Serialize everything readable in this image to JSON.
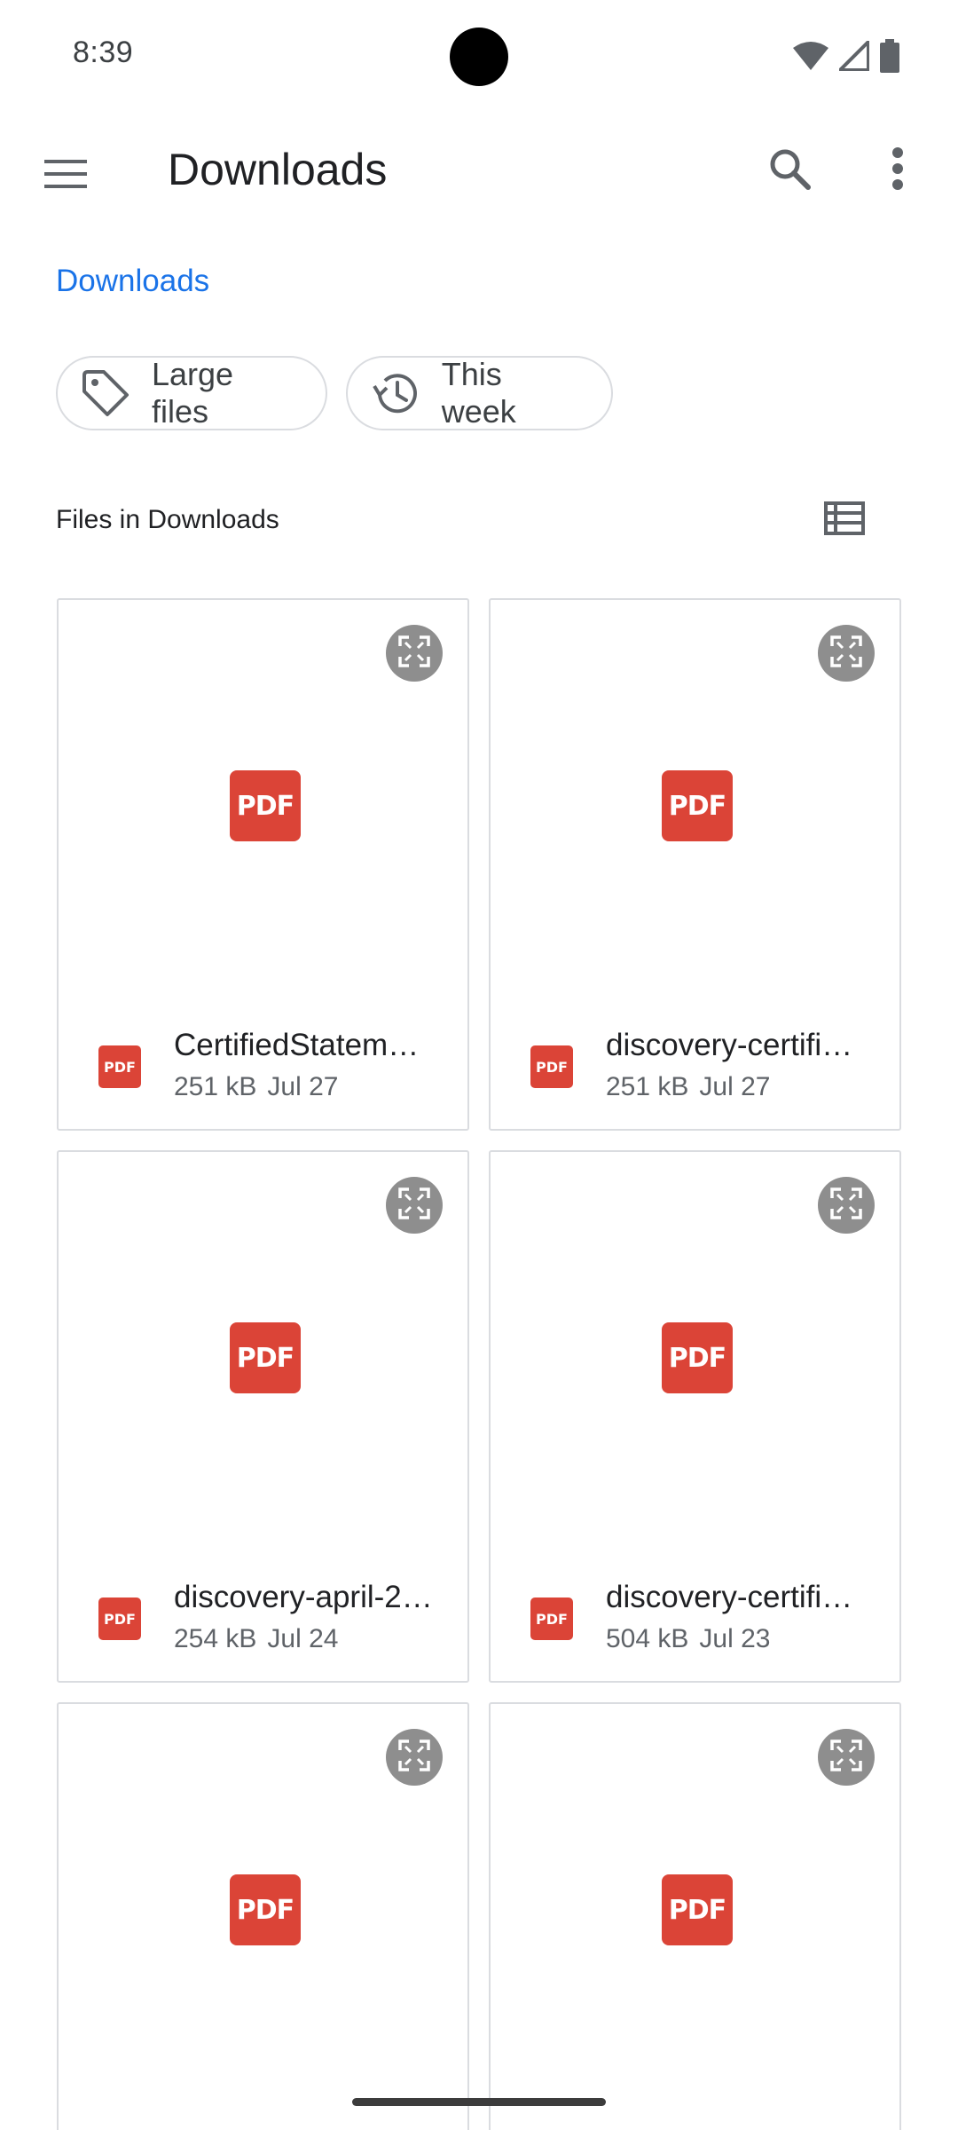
{
  "status_bar": {
    "time": "8:39",
    "icons": [
      "wifi-icon",
      "signal-icon",
      "battery-icon"
    ]
  },
  "app_bar": {
    "title": "Downloads",
    "icons": [
      "menu-icon",
      "search-icon",
      "more-vert-icon"
    ]
  },
  "breadcrumb": "Downloads",
  "chips": [
    {
      "label": "Large files",
      "icon": "label-tag-icon"
    },
    {
      "label": "This week",
      "icon": "history-icon"
    }
  ],
  "section": {
    "title": "Files in Downloads",
    "view_toggle_icon": "list-view-icon"
  },
  "files": [
    {
      "name": "CertifiedStatem…",
      "size": "251 kB",
      "date": "Jul 27",
      "type_badge": "PDF"
    },
    {
      "name": "discovery-certifi…",
      "size": "251 kB",
      "date": "Jul 27",
      "type_badge": "PDF"
    },
    {
      "name": "discovery-april-2…",
      "size": "254 kB",
      "date": "Jul 24",
      "type_badge": "PDF"
    },
    {
      "name": "discovery-certifi…",
      "size": "504 kB",
      "date": "Jul 23",
      "type_badge": "PDF"
    },
    {
      "name": "",
      "size": "",
      "date": "",
      "type_badge": "PDF"
    },
    {
      "name": "",
      "size": "",
      "date": "",
      "type_badge": "PDF"
    }
  ],
  "colors": {
    "accent": "#1a73e8",
    "pdf_red": "#db4437",
    "border": "#dadce0"
  }
}
